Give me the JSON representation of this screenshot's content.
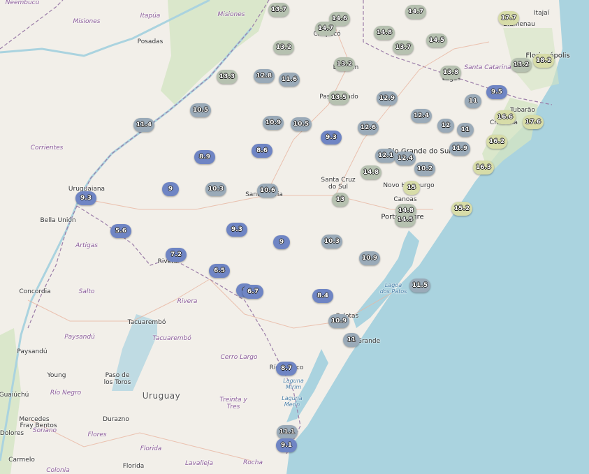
{
  "map": {
    "places": [
      {
        "name": "Neembucú",
        "kind": "region"
      },
      {
        "name": "Itapúa",
        "kind": "region"
      },
      {
        "name": "Misiones",
        "kind": "region"
      },
      {
        "name": "Misiones",
        "kind": "region"
      },
      {
        "name": "Posadas",
        "kind": "city"
      },
      {
        "name": "Corrientes",
        "kind": "region"
      },
      {
        "name": "Uruguaiana",
        "kind": "city"
      },
      {
        "name": "Bella Unión",
        "kind": "city"
      },
      {
        "name": "Artigas",
        "kind": "region"
      },
      {
        "name": "Salto",
        "kind": "region"
      },
      {
        "name": "Concordia",
        "kind": "city"
      },
      {
        "name": "Rivera",
        "kind": "city"
      },
      {
        "name": "Rivera",
        "kind": "region"
      },
      {
        "name": "Tacuarembó",
        "kind": "city"
      },
      {
        "name": "Tacuarembó",
        "kind": "region"
      },
      {
        "name": "Paysandú",
        "kind": "region"
      },
      {
        "name": "Paysandú",
        "kind": "city"
      },
      {
        "name": "Young",
        "kind": "city"
      },
      {
        "name": "Paso de\nlos Toros",
        "kind": "city"
      },
      {
        "name": "Uruguay",
        "kind": "country"
      },
      {
        "name": "Río Negro",
        "kind": "region"
      },
      {
        "name": "Fray Bentos",
        "kind": "city"
      },
      {
        "name": "Mercedes",
        "kind": "city"
      },
      {
        "name": "Soriano",
        "kind": "region"
      },
      {
        "name": "Dolores",
        "kind": "city"
      },
      {
        "name": "Carmelo",
        "kind": "city"
      },
      {
        "name": "Colonia",
        "kind": "region"
      },
      {
        "name": "Durazno",
        "kind": "city"
      },
      {
        "name": "Flores",
        "kind": "region"
      },
      {
        "name": "Florida",
        "kind": "region"
      },
      {
        "name": "Florida",
        "kind": "city"
      },
      {
        "name": "Lavalleja",
        "kind": "region"
      },
      {
        "name": "Rocha",
        "kind": "region"
      },
      {
        "name": "Treinta y\nTres",
        "kind": "region"
      },
      {
        "name": "Cerro Largo",
        "kind": "region"
      },
      {
        "name": "Río Branco",
        "kind": "city"
      },
      {
        "name": "Laguna\nMirim",
        "kind": "water"
      },
      {
        "name": "Laguna\nMerín",
        "kind": "water"
      },
      {
        "name": "Lagoa\ndos Patos",
        "kind": "water"
      },
      {
        "name": "Rio Grande",
        "kind": "city"
      },
      {
        "name": "Pelotas",
        "kind": "city"
      },
      {
        "name": "Santa Maria",
        "kind": "city"
      },
      {
        "name": "Santa Cruz\ndo Sul",
        "kind": "city"
      },
      {
        "name": "Rio Grande do Sul",
        "kind": "region-big"
      },
      {
        "name": "Novo Hamburgo",
        "kind": "city"
      },
      {
        "name": "Canoas",
        "kind": "city"
      },
      {
        "name": "Porto Alegre",
        "kind": "major"
      },
      {
        "name": "Passo Fundo",
        "kind": "city"
      },
      {
        "name": "Erechim",
        "kind": "city"
      },
      {
        "name": "Chapecó",
        "kind": "city"
      },
      {
        "name": "Santa Catarina",
        "kind": "region"
      },
      {
        "name": "Lages",
        "kind": "city"
      },
      {
        "name": "Blumenau",
        "kind": "city"
      },
      {
        "name": "Itajaí",
        "kind": "city"
      },
      {
        "name": "Florianópolis",
        "kind": "major"
      },
      {
        "name": "Tubarão",
        "kind": "city"
      },
      {
        "name": "Criciúma",
        "kind": "city"
      },
      {
        "name": "Guaiúchú",
        "kind": "city"
      }
    ],
    "legend_colors": {
      "cold": "#6f85c4",
      "mid": "#9aaab8",
      "warm": "#b6c1b0",
      "hot": "#d7dca8"
    },
    "markers": [
      {
        "value": "13.7"
      },
      {
        "value": "14.6"
      },
      {
        "value": "14.7"
      },
      {
        "value": "14.7"
      },
      {
        "value": "17.7"
      },
      {
        "value": "13.2"
      },
      {
        "value": "14.8"
      },
      {
        "value": "13.7"
      },
      {
        "value": "14.5"
      },
      {
        "value": "13.2"
      },
      {
        "value": "18.2"
      },
      {
        "value": "13.3"
      },
      {
        "value": "12.8"
      },
      {
        "value": "11.6"
      },
      {
        "value": "13.2"
      },
      {
        "value": "13.8"
      },
      {
        "value": "13.5"
      },
      {
        "value": "12.9"
      },
      {
        "value": "11"
      },
      {
        "value": "9.5"
      },
      {
        "value": "10.5"
      },
      {
        "value": "11.4"
      },
      {
        "value": "10.9"
      },
      {
        "value": "10.5"
      },
      {
        "value": "12.4"
      },
      {
        "value": "16.6"
      },
      {
        "value": "17.6"
      },
      {
        "value": "12.6"
      },
      {
        "value": "12"
      },
      {
        "value": "11"
      },
      {
        "value": "9.3"
      },
      {
        "value": "16.2"
      },
      {
        "value": "8.9"
      },
      {
        "value": "8.6"
      },
      {
        "value": "12.1"
      },
      {
        "value": "12.4"
      },
      {
        "value": "11.9"
      },
      {
        "value": "14.8"
      },
      {
        "value": "10.2"
      },
      {
        "value": "16.3"
      },
      {
        "value": "9"
      },
      {
        "value": "10.3"
      },
      {
        "value": "10.6"
      },
      {
        "value": "15"
      },
      {
        "value": "9.3"
      },
      {
        "value": "13"
      },
      {
        "value": "14.8"
      },
      {
        "value": "14.5"
      },
      {
        "value": "15.2"
      },
      {
        "value": "5.6"
      },
      {
        "value": "9.3"
      },
      {
        "value": "9"
      },
      {
        "value": "10.3"
      },
      {
        "value": "7.2"
      },
      {
        "value": "10.9"
      },
      {
        "value": "6.5"
      },
      {
        "value": "6"
      },
      {
        "value": "6.7"
      },
      {
        "value": "11.5"
      },
      {
        "value": "8.4"
      },
      {
        "value": "10.9"
      },
      {
        "value": "11"
      },
      {
        "value": "8.7"
      },
      {
        "value": "11.1"
      },
      {
        "value": "9.1"
      }
    ]
  }
}
